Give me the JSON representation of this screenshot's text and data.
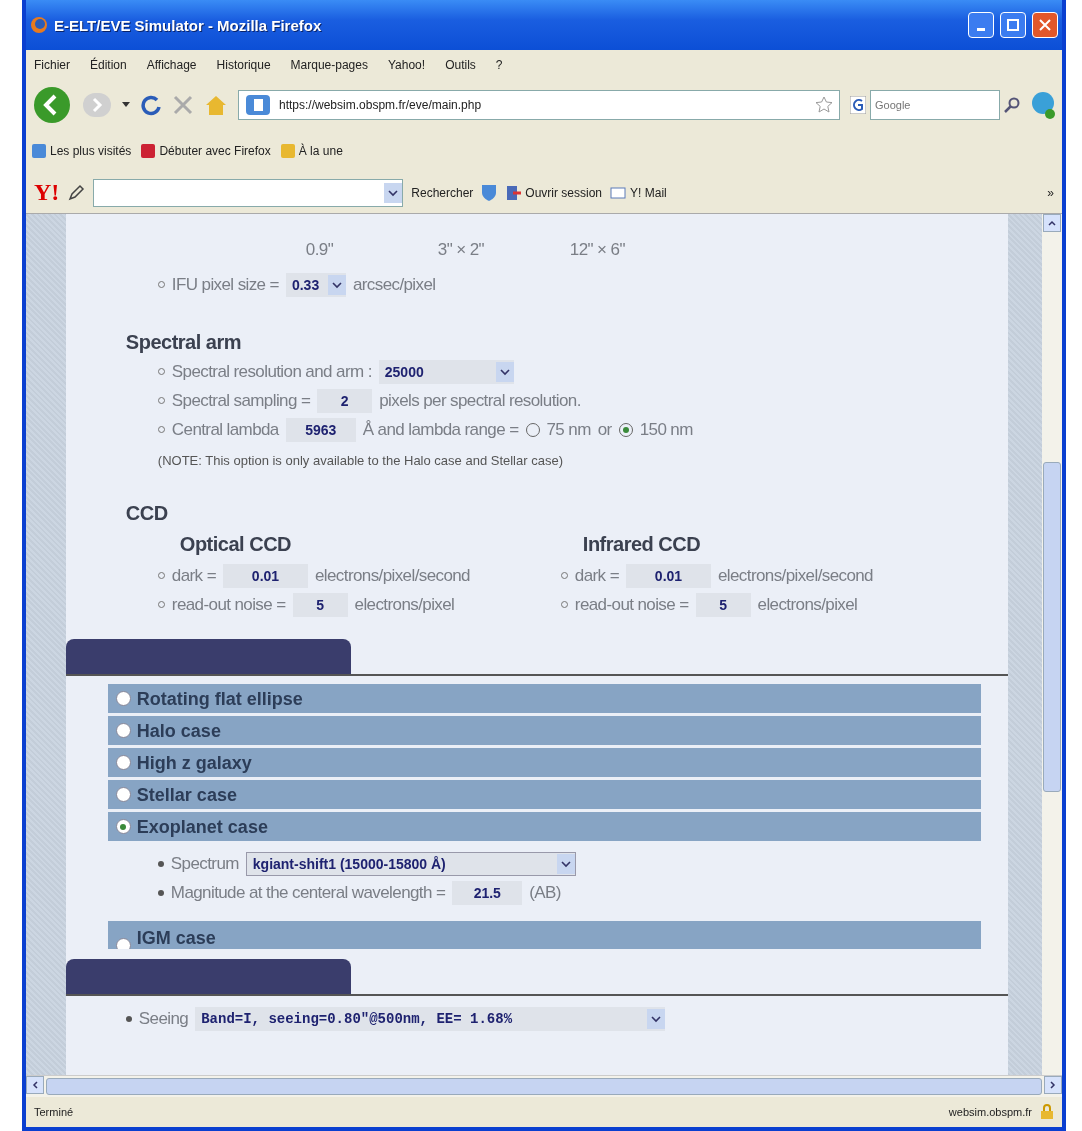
{
  "window": {
    "title": "E-ELT/EVE Simulator - Mozilla Firefox"
  },
  "menu": [
    "Fichier",
    "Édition",
    "Affichage",
    "Historique",
    "Marque-pages",
    "Yahoo!",
    "Outils",
    "?"
  ],
  "address": {
    "url": "https://websim.obspm.fr/eve/main.php"
  },
  "search": {
    "placeholder": "Google"
  },
  "bookmarks": [
    "Les plus visités",
    "Débuter avec Firefox",
    "À la une"
  ],
  "yahoo_toolbar": {
    "logo": "Y!",
    "search_label": "Rechercher",
    "login": "Ouvrir session",
    "mail": "Y! Mail",
    "more": "»"
  },
  "ifu_sizes": [
    "0.9\"",
    "3\" × 2\"",
    "12\" × 6\""
  ],
  "ifu_pixel": {
    "label": "IFU pixel size =",
    "value": "0.33",
    "unit": "arcsec/pixel"
  },
  "spectral_arm": {
    "title": "Spectral arm",
    "resolution": {
      "label": "Spectral resolution and arm :",
      "value": "25000"
    },
    "sampling": {
      "label": "Spectral sampling =",
      "value": "2",
      "unit": "pixels per spectral resolution."
    },
    "lambda": {
      "label": "Central lambda",
      "value": "5963",
      "unit": "Å and lambda range =",
      "or": "or",
      "ranges": [
        {
          "label": "75 nm",
          "selected": false
        },
        {
          "label": "150 nm",
          "selected": true
        }
      ]
    },
    "note": "(NOTE: This option is only available to the Halo case and Stellar case)"
  },
  "ccd": {
    "title": "CCD",
    "columns": [
      {
        "title": "Optical CCD",
        "dark_label": "dark =",
        "dark": "0.01",
        "dark_unit": "electrons/pixel/second",
        "noise_label": "read-out noise =",
        "noise": "5",
        "noise_unit": "electrons/pixel"
      },
      {
        "title": "Infrared CCD",
        "dark_label": "dark =",
        "dark": "0.01",
        "dark_unit": "electrons/pixel/second",
        "noise_label": "read-out noise =",
        "noise": "5",
        "noise_unit": "electrons/pixel"
      }
    ]
  },
  "targets": [
    {
      "label": "Rotating flat ellipse",
      "selected": false
    },
    {
      "label": "Halo case",
      "selected": false
    },
    {
      "label": "High z galaxy",
      "selected": false
    },
    {
      "label": "Stellar case",
      "selected": false
    },
    {
      "label": "Exoplanet case",
      "selected": true
    }
  ],
  "exoplanet": {
    "spectrum_label": "Spectrum",
    "spectrum": "kgiant-shift1 (15000-15800 Å)",
    "magnitude_label": "Magnitude at the centeral wavelength =",
    "magnitude": "21.5",
    "magnitude_unit": "(AB)"
  },
  "more_targets": [
    {
      "label": "IGM case",
      "selected": false
    }
  ],
  "seeing": {
    "label": "Seeing",
    "value": "Band=I, seeing=0.80\"@500nm, EE= 1.68%"
  },
  "status_bar": {
    "text": "Terminé",
    "host": "websim.obspm.fr"
  }
}
